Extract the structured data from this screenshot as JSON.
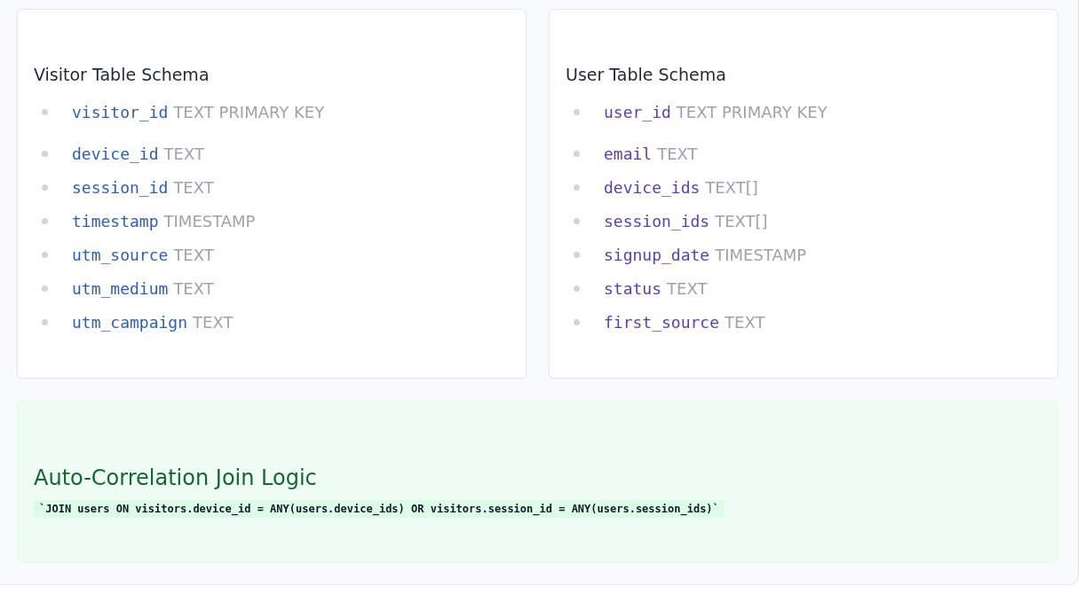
{
  "schemas": [
    {
      "title": "Visitor Table Schema",
      "color": "#2f5fb3",
      "fields": [
        {
          "name": "visitor_id",
          "type": "TEXT PRIMARY KEY"
        },
        {
          "name": "device_id",
          "type": "TEXT"
        },
        {
          "name": "session_id",
          "type": "TEXT"
        },
        {
          "name": "timestamp",
          "type": "TIMESTAMP"
        },
        {
          "name": "utm_source",
          "type": "TEXT"
        },
        {
          "name": "utm_medium",
          "type": "TEXT"
        },
        {
          "name": "utm_campaign",
          "type": "TEXT"
        }
      ]
    },
    {
      "title": "User Table Schema",
      "color": "#5b3fb0",
      "fields": [
        {
          "name": "user_id",
          "type": "TEXT PRIMARY KEY"
        },
        {
          "name": "email",
          "type": "TEXT"
        },
        {
          "name": "device_ids",
          "type": "TEXT[]"
        },
        {
          "name": "session_ids",
          "type": "TEXT[]"
        },
        {
          "name": "signup_date",
          "type": "TIMESTAMP"
        },
        {
          "name": "status",
          "type": "TEXT"
        },
        {
          "name": "first_source",
          "type": "TEXT"
        }
      ]
    }
  ],
  "join": {
    "title": "Auto-Correlation Join Logic",
    "code": "`JOIN users ON visitors.device_id = ANY(users.device_ids) OR visitors.session_id = ANY(users.session_ids)`"
  }
}
